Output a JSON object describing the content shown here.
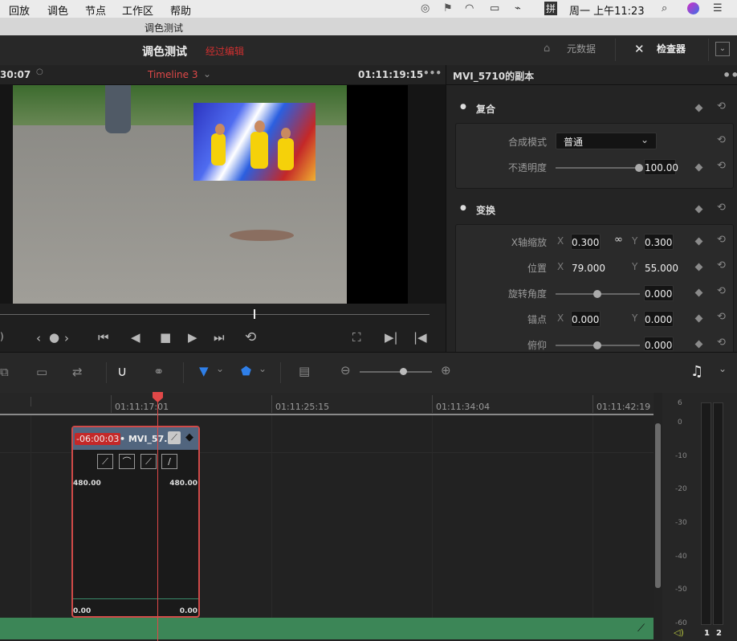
{
  "menubar": {
    "items": [
      "回放",
      "调色",
      "节点",
      "工作区",
      "帮助"
    ],
    "clock": "周一 上午11:23",
    "input_method": "拼",
    "icons": [
      "creative-cloud-icon",
      "flag-icon",
      "wifi-icon",
      "airplay-icon",
      "battery-icon",
      "input-method-icon",
      "search-icon",
      "siri-icon",
      "control-center-icon"
    ]
  },
  "window": {
    "title": "调色测试"
  },
  "header": {
    "project_name": "调色测试",
    "edited_label": "经过编辑",
    "metadata_label": "元数据",
    "inspector_label": "检查器"
  },
  "viewer": {
    "left_timecode": "30:07",
    "timeline_name": "Timeline 3",
    "right_timecode": "01:11:19:15"
  },
  "inspector": {
    "clip_name": "MVI_5710的副本",
    "composite": {
      "title": "复合",
      "mode_label": "合成模式",
      "mode_value": "普通",
      "opacity_label": "不透明度",
      "opacity_value": "100.00",
      "opacity_fraction": 1.0
    },
    "transform": {
      "title": "变换",
      "zoom_label": "X轴缩放",
      "zoom_x": "0.300",
      "zoom_y": "0.300",
      "position_label": "位置",
      "position_x": "79.000",
      "position_y": "55.000",
      "rotation_label": "旋转角度",
      "rotation_value": "0.000",
      "anchor_label": "锚点",
      "anchor_x": "0.000",
      "anchor_y": "0.000",
      "pitch_label": "俯仰",
      "pitch_value": "0.000",
      "x_axis": "X",
      "y_axis": "Y"
    }
  },
  "timeline": {
    "ruler": [
      "01:11:17:01",
      "01:11:25:15",
      "01:11:34:04",
      "01:11:42:19"
    ],
    "clip": {
      "offset": "-06:00:03",
      "name": "• MVI_57...",
      "top_left": "480.00",
      "top_right": "480.00",
      "bottom_left": "0.00",
      "bottom_right": "0.00"
    },
    "meter_ticks": [
      "6",
      "0",
      "-10",
      "-20",
      "-30",
      "-40",
      "-50",
      "-60"
    ],
    "channels": [
      "1",
      "2"
    ]
  },
  "colors": {
    "accent_red": "#d03030",
    "clip_border": "#d04a48",
    "clip_header": "#51657e",
    "audio_track": "#3c8657",
    "flag_blue": "#2f7fe8"
  }
}
